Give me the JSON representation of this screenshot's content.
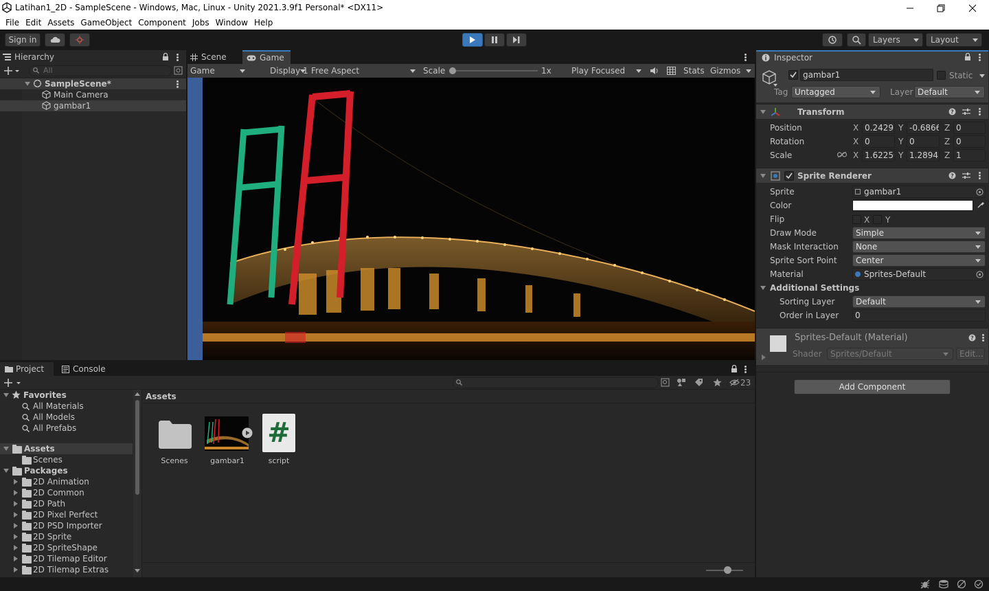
{
  "window": {
    "title": "Latihan1_2D - SampleScene - Windows, Mac, Linux - Unity 2021.3.9f1 Personal* <DX11>"
  },
  "menu": [
    "File",
    "Edit",
    "Assets",
    "GameObject",
    "Component",
    "Jobs",
    "Window",
    "Help"
  ],
  "toolbar": {
    "signin": "Sign in",
    "layers": "Layers",
    "layout": "Layout"
  },
  "hierarchy": {
    "tab": "Hierarchy",
    "search_placeholder": "All",
    "scene": "SampleScene*",
    "items": [
      "Main Camera",
      "gambar1"
    ]
  },
  "game": {
    "tabs": [
      "Scene",
      "Game"
    ],
    "view_dropdown": "Game",
    "display": "Display 1",
    "aspect": "Free Aspect",
    "scale_label": "Scale",
    "scale_value": "1x",
    "play_focused": "Play Focused",
    "stats": "Stats",
    "gizmos": "Gizmos"
  },
  "inspector": {
    "tab": "Inspector",
    "object_name": "gambar1",
    "static_label": "Static",
    "tag_label": "Tag",
    "tag_value": "Untagged",
    "layer_label": "Layer",
    "layer_value": "Default",
    "transform": {
      "title": "Transform",
      "position_label": "Position",
      "rotation_label": "Rotation",
      "scale_label": "Scale",
      "position": {
        "x": "0.2429",
        "y": "-0.6866",
        "z": "0"
      },
      "rotation": {
        "x": "0",
        "y": "0",
        "z": "0"
      },
      "scale": {
        "x": "1.62250",
        "y": "1.28942",
        "z": "1"
      }
    },
    "sprite_renderer": {
      "title": "Sprite Renderer",
      "sprite_label": "Sprite",
      "sprite_value": "gambar1",
      "color_label": "Color",
      "color_value": "#ffffff",
      "flip_label": "Flip",
      "flip_x": "X",
      "flip_y": "Y",
      "draw_mode_label": "Draw Mode",
      "draw_mode_value": "Simple",
      "mask_label": "Mask Interaction",
      "mask_value": "None",
      "sort_point_label": "Sprite Sort Point",
      "sort_point_value": "Center",
      "material_label": "Material",
      "material_value": "Sprites-Default",
      "additional_label": "Additional Settings",
      "sorting_layer_label": "Sorting Layer",
      "sorting_layer_value": "Default",
      "order_label": "Order in Layer",
      "order_value": "0"
    },
    "material": {
      "name": "Sprites-Default (Material)",
      "shader_label": "Shader",
      "shader_value": "Sprites/Default",
      "edit": "Edit..."
    },
    "add_component": "Add Component"
  },
  "project": {
    "tabs": [
      "Project",
      "Console"
    ],
    "hidden_count": "23",
    "breadcrumb": "Assets",
    "favorites_label": "Favorites",
    "favorites": [
      "All Materials",
      "All Models",
      "All Prefabs"
    ],
    "assets_label": "Assets",
    "assets_children": [
      "Scenes"
    ],
    "packages_label": "Packages",
    "packages": [
      "2D Animation",
      "2D Common",
      "2D Path",
      "2D Pixel Perfect",
      "2D PSD Importer",
      "2D Sprite",
      "2D SpriteShape",
      "2D Tilemap Editor",
      "2D Tilemap Extras"
    ],
    "grid_items": [
      "Scenes",
      "gambar1",
      "script"
    ]
  },
  "colors": {
    "accent": "#3a79bb",
    "play_button": "#3a79bb",
    "game_sky": "#050505"
  }
}
